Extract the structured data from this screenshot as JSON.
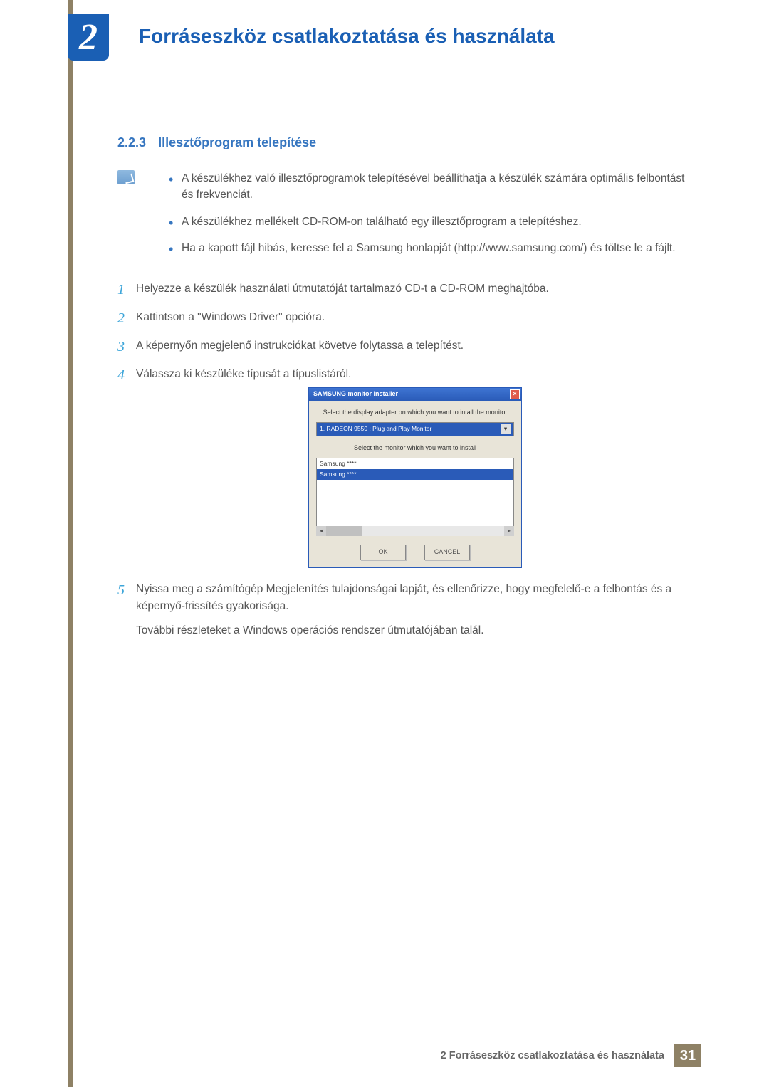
{
  "chapter": {
    "number": "2",
    "title": "Forráseszköz csatlakoztatása és használata"
  },
  "section": {
    "number": "2.2.3",
    "title": "Illesztőprogram telepítése"
  },
  "notes": [
    "A készülékhez való illesztőprogramok telepítésével beállíthatja a készülék számára optimális felbontást és frekvenciát.",
    "A készülékhez mellékelt CD-ROM-on található egy illesztőprogram a telepítéshez.",
    "Ha a kapott fájl hibás, keresse fel a Samsung honlapját (http://www.samsung.com/) és töltse le a fájlt."
  ],
  "steps": [
    {
      "n": "1",
      "text": "Helyezze a készülék használati útmutatóját tartalmazó CD-t a CD-ROM meghajtóba."
    },
    {
      "n": "2",
      "text": "Kattintson a \"Windows Driver\" opcióra."
    },
    {
      "n": "3",
      "text": "A képernyőn megjelenő instrukciókat követve folytassa a telepítést."
    },
    {
      "n": "4",
      "text": "Válassza ki készüléke típusát a típuslistáról."
    },
    {
      "n": "5",
      "text": "Nyissa meg a számítógép Megjelenítés tulajdonságai lapját, és ellenőrizze, hogy megfelelő-e a felbontás és a képernyő-frissítés gyakorisága.",
      "extra": "További részleteket a Windows operációs rendszer útmutatójában talál."
    }
  ],
  "installer": {
    "title": "SAMSUNG monitor installer",
    "label_adapter": "Select the display adapter on which you want to intall the monitor",
    "adapter_value": "1. RADEON 9550 : Plug and Play Monitor",
    "label_monitor": "Select the monitor which you want to install",
    "monitors": [
      "Samsung ****",
      "Samsung ****"
    ],
    "ok": "OK",
    "cancel": "CANCEL"
  },
  "footer": {
    "text": "2 Forráseszköz csatlakoztatása és használata",
    "page": "31"
  }
}
